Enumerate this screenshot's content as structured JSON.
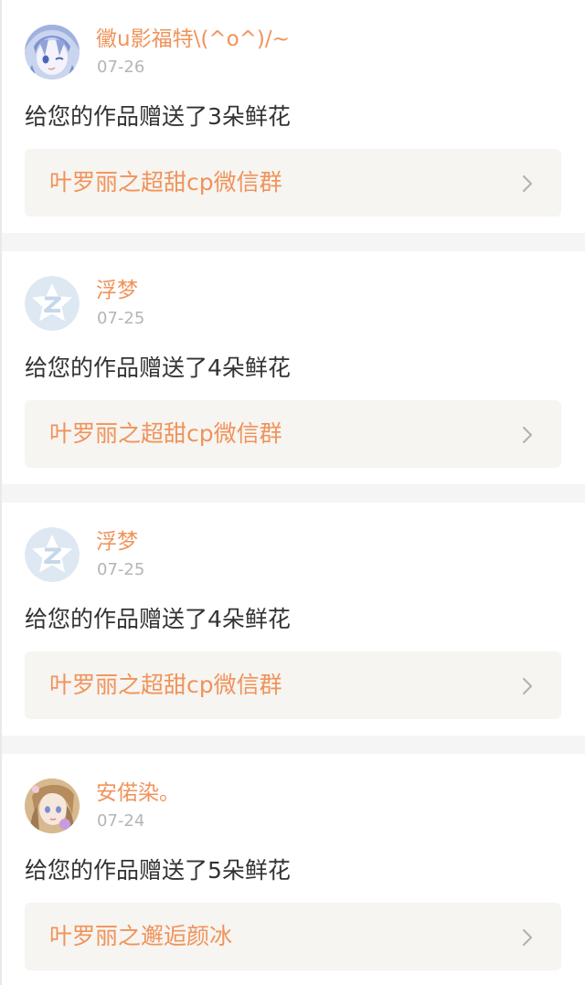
{
  "notifications": [
    {
      "username": "黴u影福特\\(^o^)/~",
      "date": "07-26",
      "message": "给您的作品赠送了3朵鲜花",
      "work_title": "叶罗丽之超甜cp微信群",
      "avatar_icon": "anime-girl-avatar"
    },
    {
      "username": "浮梦",
      "date": "07-25",
      "message": "给您的作品赠送了4朵鲜花",
      "work_title": "叶罗丽之超甜cp微信群",
      "avatar_icon": "default-z-star-avatar"
    },
    {
      "username": "浮梦",
      "date": "07-25",
      "message": "给您的作品赠送了4朵鲜花",
      "work_title": "叶罗丽之超甜cp微信群",
      "avatar_icon": "default-z-star-avatar"
    },
    {
      "username": "安偌染。",
      "date": "07-24",
      "message": "给您的作品赠送了5朵鲜花",
      "work_title": "叶罗丽之邂逅颜冰",
      "avatar_icon": "anime-girl-avatar"
    }
  ],
  "colors": {
    "accent": "#f0935b",
    "date_gray": "#b5b5b5",
    "text": "#333333",
    "card_bg": "#f6f5f1",
    "divider": "#f5f5f5",
    "default_avatar": "#dde8f3"
  }
}
